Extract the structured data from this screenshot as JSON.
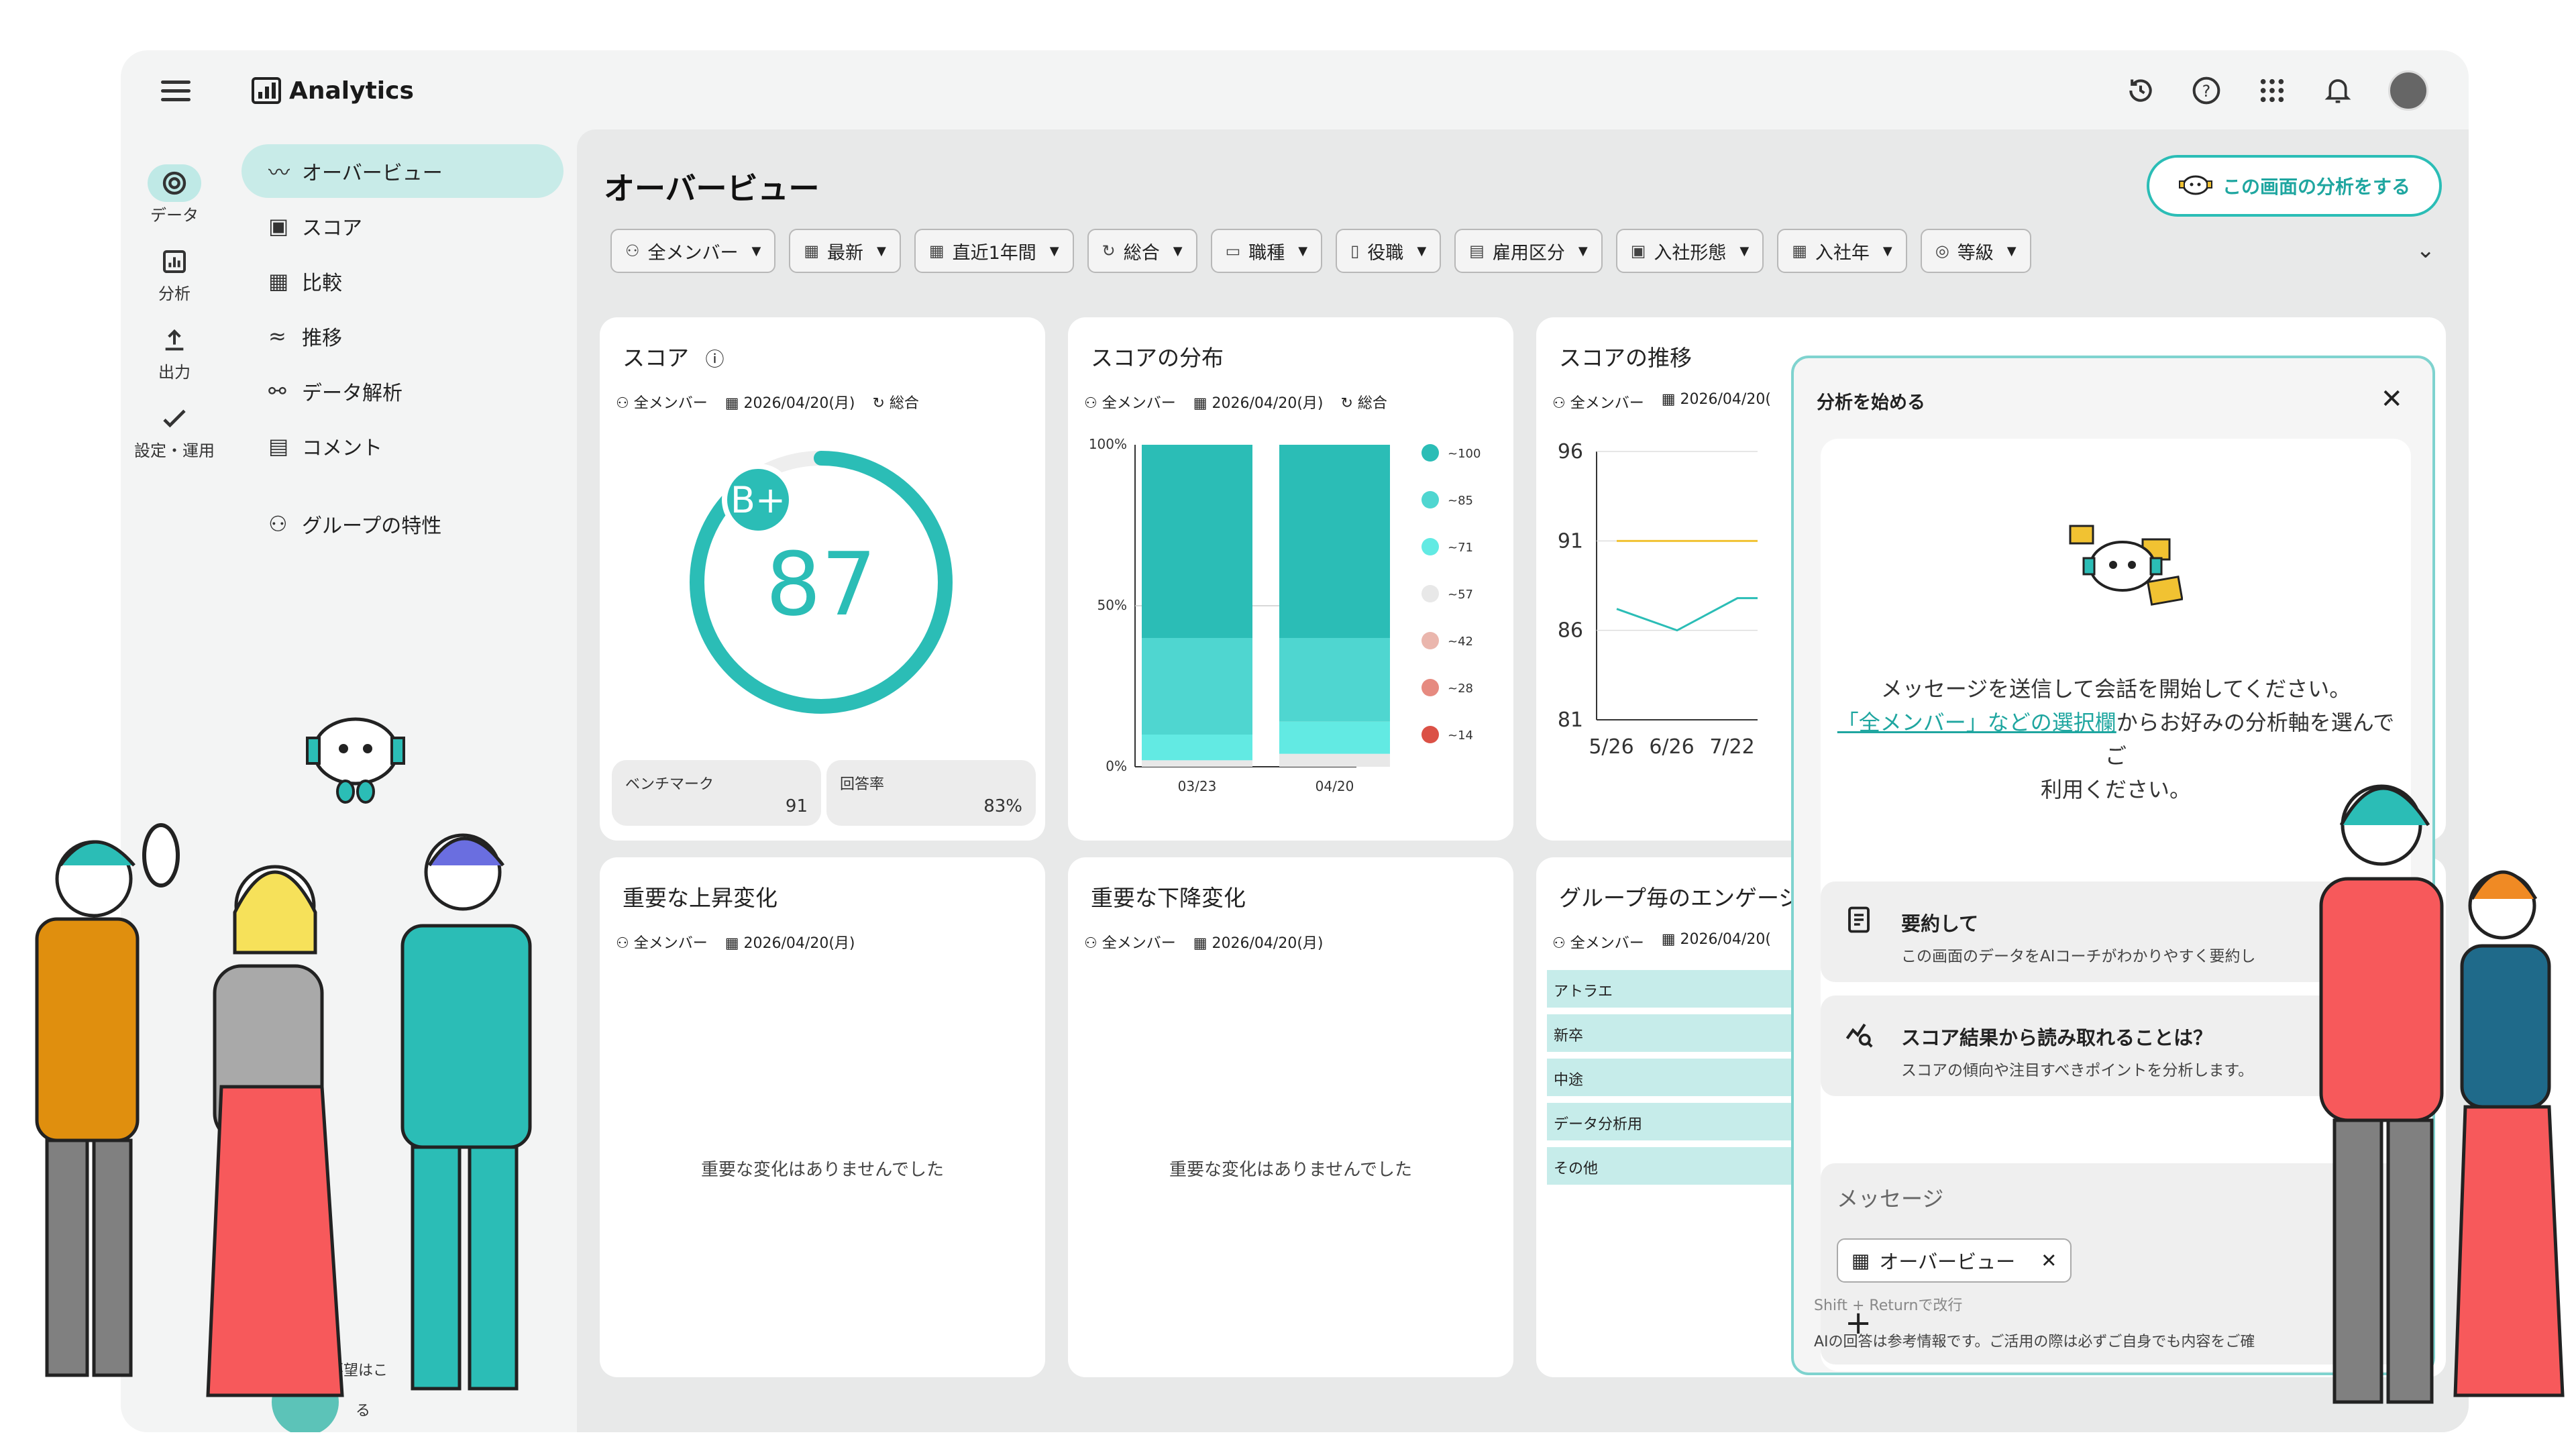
{
  "app": {
    "title": "Analytics"
  },
  "rail": [
    {
      "label": "データ",
      "icon": "data-icon"
    },
    {
      "label": "分析",
      "icon": "chart-icon"
    },
    {
      "label": "出力",
      "icon": "upload-icon"
    },
    {
      "label": "設定・運用",
      "icon": "settings-check-icon"
    }
  ],
  "nav": {
    "items": [
      {
        "label": "オーバービュー",
        "icon": "overview-icon"
      },
      {
        "label": "スコア",
        "icon": "score-icon"
      },
      {
        "label": "比較",
        "icon": "table-icon"
      },
      {
        "label": "推移",
        "icon": "trend-icon"
      },
      {
        "label": "データ解析",
        "icon": "analysis-icon"
      },
      {
        "label": "コメント",
        "icon": "comment-icon"
      }
    ],
    "group": {
      "label": "グループの特性",
      "icon": "group-icon"
    },
    "partial1": "要望はこ",
    "partial2": "る"
  },
  "page": {
    "title": "オーバービュー",
    "analyze_button": "この画面の分析をする"
  },
  "filters": [
    {
      "label": "全メンバー",
      "icon": "members-icon"
    },
    {
      "label": "最新",
      "icon": "calendar-icon"
    },
    {
      "label": "直近1年間",
      "icon": "calendar-icon"
    },
    {
      "label": "総合",
      "icon": "refresh-icon"
    },
    {
      "label": "職種",
      "icon": "briefcase-icon"
    },
    {
      "label": "役職",
      "icon": "badge-icon"
    },
    {
      "label": "雇用区分",
      "icon": "document-icon"
    },
    {
      "label": "入社形態",
      "icon": "id-card-icon"
    },
    {
      "label": "入社年",
      "icon": "calendar-icon"
    },
    {
      "label": "等級",
      "icon": "rank-icon"
    }
  ],
  "cards": {
    "score": {
      "title": "スコア",
      "members": "全メンバー",
      "date": "2026/04/20(月)",
      "mode": "総合",
      "grade": "B+",
      "value": "87",
      "fraction": 0.87,
      "benchmark_label": "ベンチマーク",
      "benchmark_value": "91",
      "response_label": "回答率",
      "response_value": "83%"
    },
    "distribution": {
      "title": "スコアの分布",
      "members": "全メンバー",
      "date": "2026/04/20(月)",
      "mode": "総合"
    },
    "trend": {
      "title": "スコアの推移",
      "members": "全メンバー",
      "date": "2026/04/20("
    },
    "up": {
      "title": "重要な上昇変化",
      "members": "全メンバー",
      "date": "2026/04/20(月)",
      "empty": "重要な変化はありませんでした"
    },
    "down": {
      "title": "重要な下降変化",
      "members": "全メンバー",
      "date": "2026/04/20(月)",
      "empty": "重要な変化はありませんでした"
    },
    "engagement": {
      "title": "グループ毎のエンゲージ",
      "members": "全メンバー",
      "date": "2026/04/20(",
      "rows": [
        "アトラエ",
        "新卒",
        "中途",
        "データ分析用",
        "その他"
      ]
    }
  },
  "chart_data": [
    {
      "type": "bar",
      "stacked": true,
      "categories": [
        "03/23",
        "04/20"
      ],
      "yticks": [
        "100%",
        "50%",
        "0%"
      ],
      "series": [
        {
          "name": "~100",
          "color": "#2bbdb6",
          "values": [
            60,
            60
          ]
        },
        {
          "name": "~85",
          "color": "#4fd6d0",
          "values": [
            30,
            26
          ]
        },
        {
          "name": "~71",
          "color": "#62eae3",
          "values": [
            8,
            10
          ]
        },
        {
          "name": "~57",
          "color": "#e8e8e8",
          "values": [
            2,
            4
          ]
        },
        {
          "name": "~42",
          "color": "#eab6ad",
          "values": [
            0,
            0
          ]
        },
        {
          "name": "~28",
          "color": "#e68a80",
          "values": [
            0,
            0
          ]
        },
        {
          "name": "~14",
          "color": "#db5146",
          "values": [
            0,
            0
          ]
        }
      ],
      "ylim": [
        0,
        100
      ]
    },
    {
      "type": "line",
      "x": [
        "5/26",
        "6/26",
        "7/22"
      ],
      "yticks": [
        "96",
        "91",
        "86",
        "81"
      ],
      "ylim": [
        81,
        96
      ],
      "series": [
        {
          "color": "#2bbdb6",
          "values": [
            87.2,
            86.0,
            87.8
          ]
        },
        {
          "color": "#f1c232",
          "values": [
            91,
            91,
            91
          ]
        }
      ]
    }
  ],
  "chat": {
    "title": "分析を始める",
    "intro_line1": "メッセージを送信して会話を開始してください。",
    "intro_link": "「全メンバー」などの選択欄",
    "intro_line2": "からお好みの分析軸を選んでご",
    "intro_line3": "利用ください。",
    "suggestions": [
      {
        "title": "要約して",
        "desc": "この画面のデータをAIコーチがわかりやすく要約し"
      },
      {
        "title": "スコア結果から読み取れることは？",
        "desc": "スコアの傾向や注目すべきポイントを分析します。"
      }
    ],
    "message_placeholder": "メッセージ",
    "chip_label": "オーバービュー",
    "hint": "Shift + Returnで改行",
    "disclaimer": "AIの回答は参考情報です。ご活用の際は必ずご自身でも内容をご確"
  }
}
